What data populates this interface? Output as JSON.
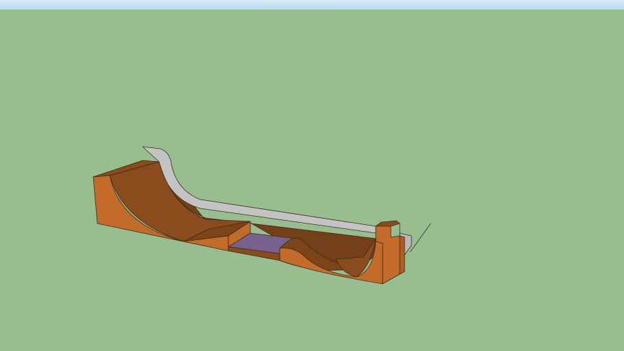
{
  "scene": {
    "model": "skatepark-ramp",
    "colors": {
      "ground": "#98bd8f",
      "sky": "#c4e2f4",
      "wood_side": "#c26b2a",
      "wood_surface": "#8b4c1d",
      "wood_dark": "#74401a",
      "coping": "#c3c3c3",
      "flat_panel": "#76628c",
      "edge": "#3a2a1a"
    }
  }
}
